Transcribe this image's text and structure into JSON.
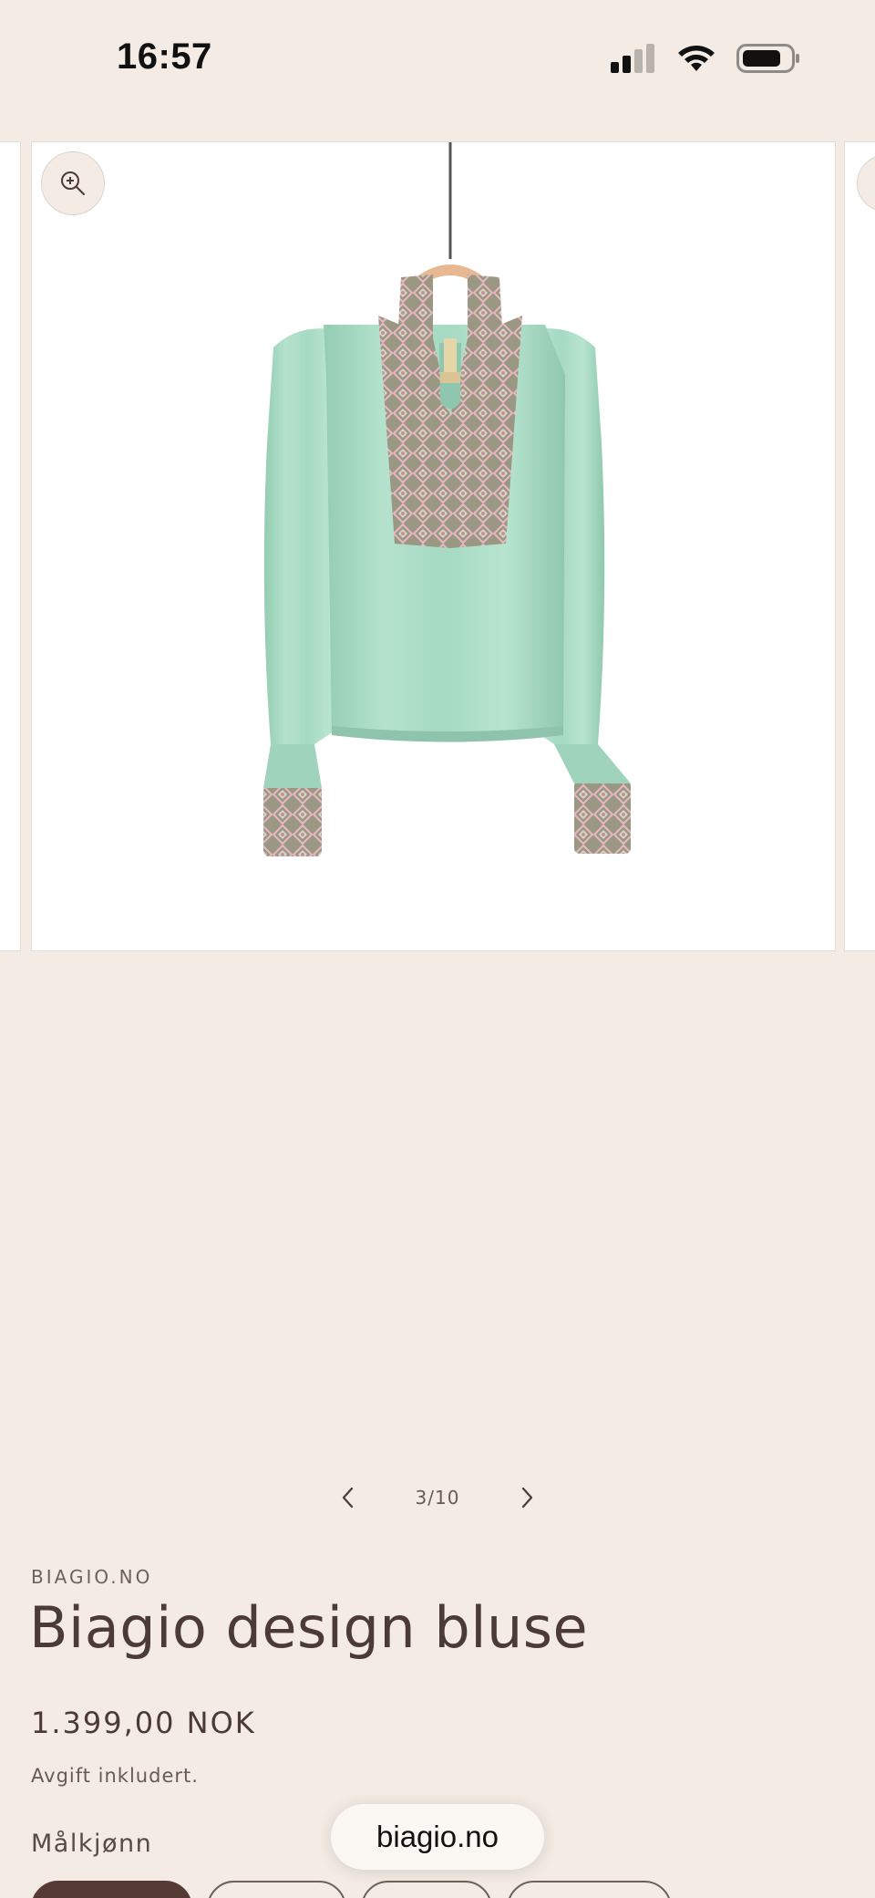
{
  "status_bar": {
    "time": "16:57",
    "icons": [
      "cellular-signal-icon",
      "wifi-icon",
      "battery-icon"
    ]
  },
  "gallery": {
    "counter": "3/10",
    "current_index": 3,
    "total": 10,
    "icons": [
      "zoom-in-icon",
      "chevron-left-icon",
      "chevron-right-icon"
    ],
    "image_alt": ""
  },
  "product": {
    "vendor": "BIAGIO.NO",
    "title": "Biagio design bluse",
    "price": "1.399,00 NOK",
    "tax_note": "Avgift inkludert.",
    "size_label": "Målkjønn",
    "size_options": [
      "",
      "",
      "",
      ""
    ],
    "selected_size_index": 0
  },
  "browser": {
    "url": "biagio.no"
  },
  "colors": {
    "background": "#f3ebe4",
    "text": "#4b3a35",
    "selected_pill": "#553b33",
    "blouse": "#a9dcc4"
  }
}
